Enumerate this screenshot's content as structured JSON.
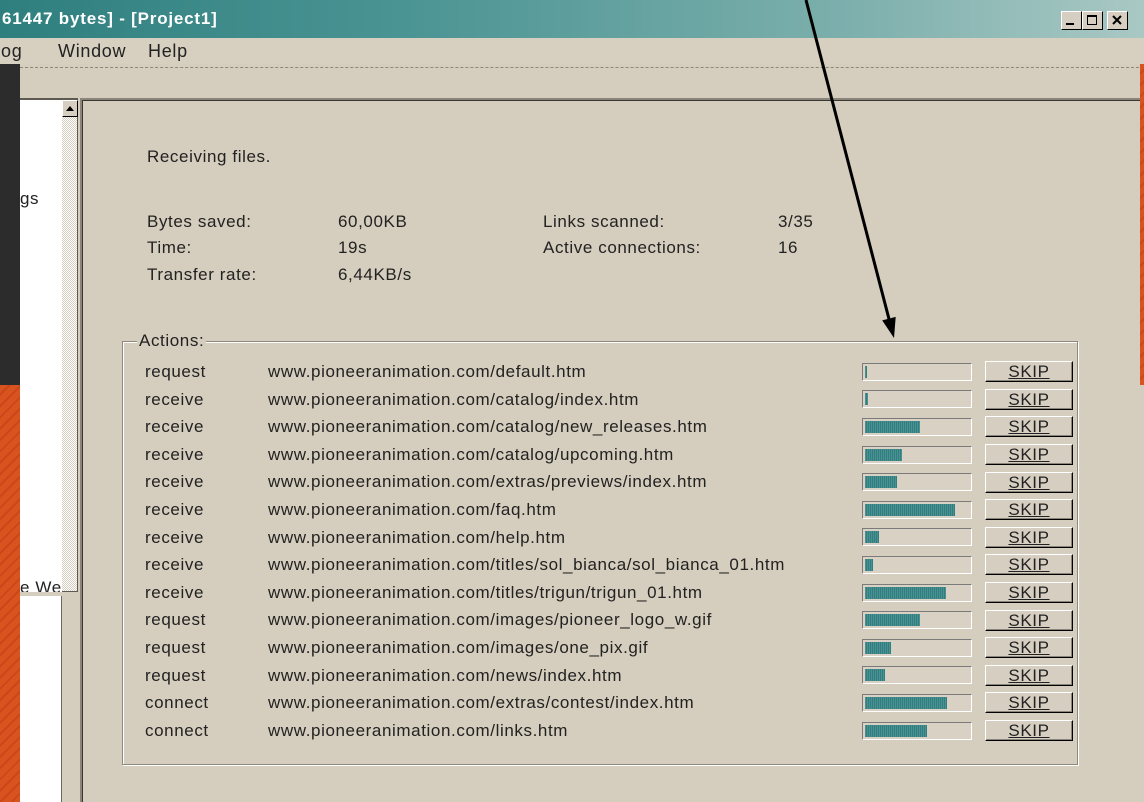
{
  "window": {
    "title": "61447 bytes] - [Project1]",
    "controls": {
      "minimize": "minimize-icon",
      "maximize": "maximize-icon",
      "close": "close-icon"
    }
  },
  "menu": {
    "items": [
      "og",
      "Window",
      "Help"
    ]
  },
  "tree": {
    "items": [
      "gs",
      "e We"
    ],
    "scroll_up_icon": "scroll-up-arrow-icon"
  },
  "progress": {
    "status": "Receiving files.",
    "bytes_saved": {
      "label": "Bytes saved:",
      "value": "60,00KB"
    },
    "time": {
      "label": "Time:",
      "value": "19s"
    },
    "transfer_rate": {
      "label": "Transfer rate:",
      "value": "6,44KB/s"
    },
    "links_scanned": {
      "label": "Links scanned:",
      "value": "3/35"
    },
    "active_connections": {
      "label": "Active connections:",
      "value": "16"
    }
  },
  "actions": {
    "legend": "Actions:",
    "skip_label": "SKIP",
    "rows": [
      {
        "action": "request",
        "url": "www.pioneeranimation.com/default.htm",
        "progress": 0.02
      },
      {
        "action": "receive",
        "url": "www.pioneeranimation.com/catalog/index.htm",
        "progress": 0.03
      },
      {
        "action": "receive",
        "url": "www.pioneeranimation.com/catalog/new_releases.htm",
        "progress": 0.53
      },
      {
        "action": "receive",
        "url": "www.pioneeranimation.com/catalog/upcoming.htm",
        "progress": 0.36
      },
      {
        "action": "receive",
        "url": "www.pioneeranimation.com/extras/previews/index.htm",
        "progress": 0.31
      },
      {
        "action": "receive",
        "url": "www.pioneeranimation.com/faq.htm",
        "progress": 0.87
      },
      {
        "action": "receive",
        "url": "www.pioneeranimation.com/help.htm",
        "progress": 0.13
      },
      {
        "action": "receive",
        "url": "www.pioneeranimation.com/titles/sol_bianca/sol_bianca_01.htm",
        "progress": 0.08
      },
      {
        "action": "receive",
        "url": "www.pioneeranimation.com/titles/trigun/trigun_01.htm",
        "progress": 0.78
      },
      {
        "action": "request",
        "url": "www.pioneeranimation.com/images/pioneer_logo_w.gif",
        "progress": 0.53
      },
      {
        "action": "request",
        "url": "www.pioneeranimation.com/images/one_pix.gif",
        "progress": 0.25
      },
      {
        "action": "request",
        "url": "www.pioneeranimation.com/news/index.htm",
        "progress": 0.19
      },
      {
        "action": "connect",
        "url": "www.pioneeranimation.com/extras/contest/index.htm",
        "progress": 0.79
      },
      {
        "action": "connect",
        "url": "www.pioneeranimation.com/links.htm",
        "progress": 0.6
      }
    ]
  },
  "colors": {
    "title_bar": "#3b8a89",
    "panel_background": "#d5cdbd",
    "progress_fill": "#2f7e80",
    "slide_orange": "#d9531f",
    "slide_dark": "#2c2c2c",
    "annotation_arrow": "#000000"
  }
}
